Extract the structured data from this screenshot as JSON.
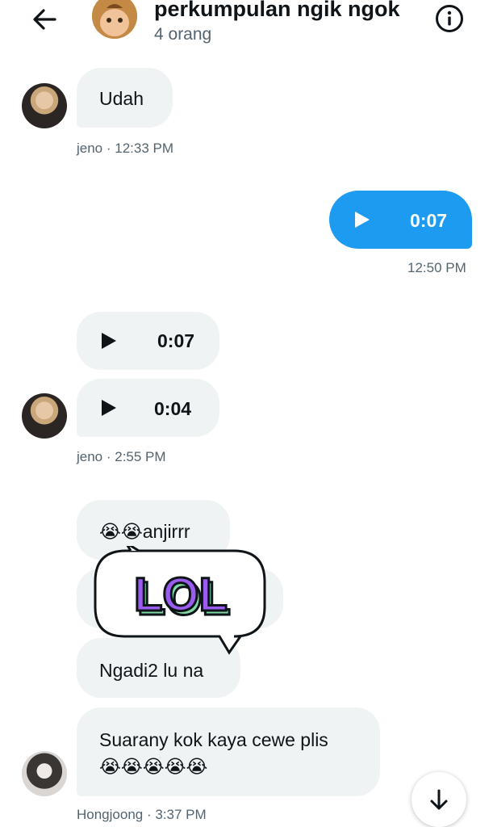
{
  "header": {
    "title": "perkumpulan ngik ngok",
    "subtitle": "4 orang"
  },
  "messages": {
    "m1": {
      "text": "Udah",
      "meta": "jeno · 12:33 PM"
    },
    "m2": {
      "duration": "0:07",
      "meta": "12:50 PM"
    },
    "m3": {
      "duration": "0:07"
    },
    "m4": {
      "duration": "0:04",
      "meta": "jeno · 2:55 PM"
    },
    "m5": {
      "text": "😭😭anjirrr"
    },
    "m7": {
      "text": "Ngadi2 lu na"
    },
    "m8": {
      "line1": "Suarany kok kaya cewe plis",
      "line2": "😭😭😭😭😭",
      "meta": "Hongjoong · 3:37 PM"
    }
  },
  "sticker": {
    "text": "LOL"
  },
  "colors": {
    "accent": "#1d9bf0",
    "bubble": "#eff3f4",
    "meta": "#536471",
    "sticker_purple": "#9b5cf0",
    "sticker_green": "#7fd9a6"
  },
  "icons": {
    "back": "arrow-left-icon",
    "info": "info-icon",
    "play": "play-icon",
    "scroll": "arrow-down-icon"
  }
}
